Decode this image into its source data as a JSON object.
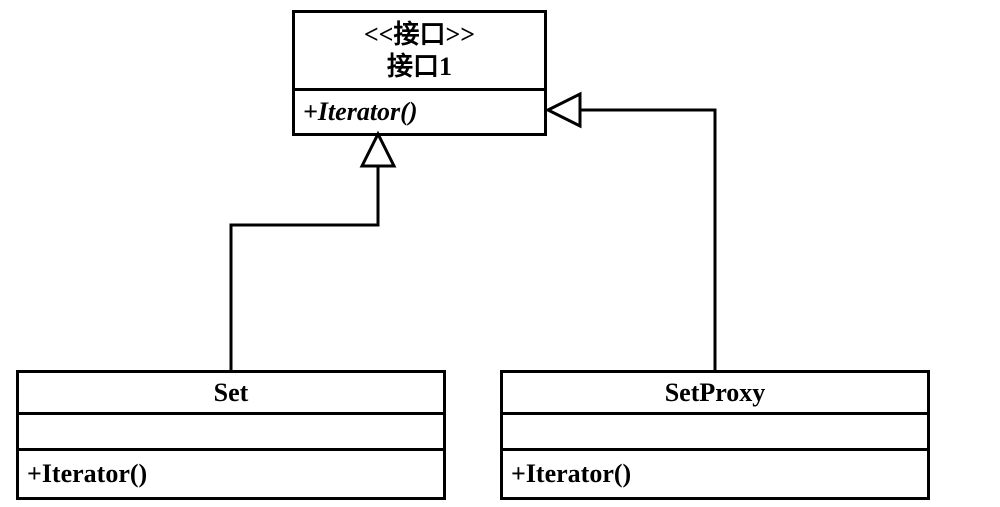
{
  "interface": {
    "stereotype": "<<接口>>",
    "name": "接口1",
    "method": "+Iterator()"
  },
  "classes": {
    "set": {
      "name": "Set",
      "method": "+Iterator()"
    },
    "setProxy": {
      "name": "SetProxy",
      "method": "+Iterator()"
    }
  },
  "chart_data": {
    "type": "uml-class-diagram",
    "entities": [
      {
        "id": "interface1",
        "kind": "interface",
        "stereotype": "<<接口>>",
        "name": "接口1",
        "attributes": [],
        "operations": [
          "+Iterator()"
        ],
        "operationsAbstract": true
      },
      {
        "id": "Set",
        "kind": "class",
        "name": "Set",
        "attributes": [],
        "operations": [
          "+Iterator()"
        ]
      },
      {
        "id": "SetProxy",
        "kind": "class",
        "name": "SetProxy",
        "attributes": [],
        "operations": [
          "+Iterator()"
        ]
      }
    ],
    "relationships": [
      {
        "type": "realization",
        "from": "Set",
        "to": "interface1"
      },
      {
        "type": "realization",
        "from": "SetProxy",
        "to": "interface1"
      }
    ]
  }
}
